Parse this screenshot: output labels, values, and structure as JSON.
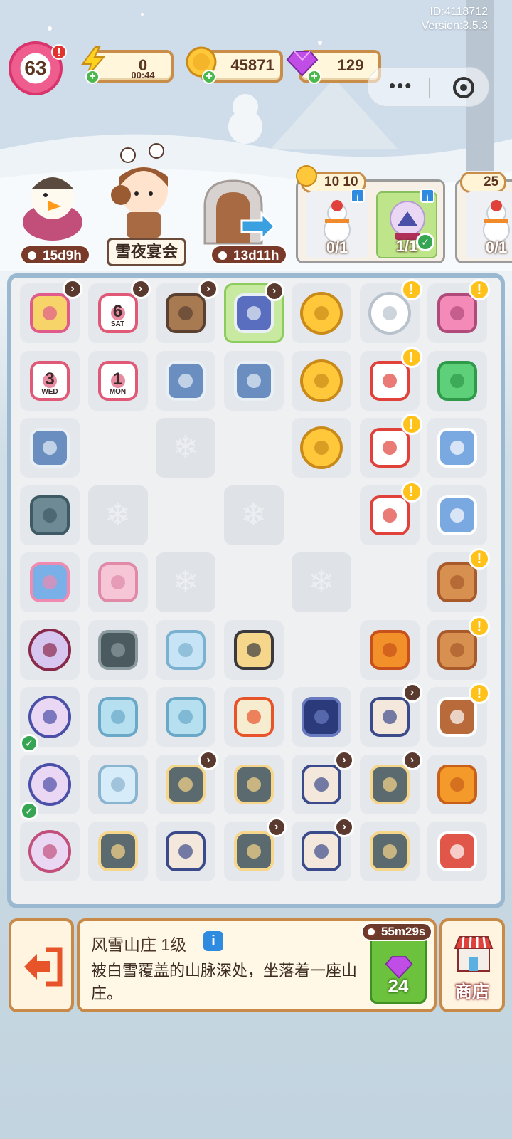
{
  "header": {
    "player_id": "ID:4118712",
    "version": "Version:3.5.3",
    "level": "63",
    "level_alert": "!",
    "energy": {
      "value": "0",
      "timer": "00:44",
      "icon": "lightning-icon"
    },
    "coins": {
      "value": "45871",
      "icon": "coin-icon"
    },
    "gems": {
      "value": "129",
      "icon": "gem-icon"
    },
    "plus": "+",
    "capsule": {
      "more": "•••",
      "close_icon": "record-icon"
    }
  },
  "events": {
    "penguin_timer": "15d9h",
    "banquet_label": "雪夜宴会",
    "door_timer": "13d11h"
  },
  "orders": [
    {
      "cost_coins": "10",
      "cost_coins2": "10",
      "slots": [
        {
          "progress": "0/1",
          "done": false
        },
        {
          "progress": "1/1",
          "done": true
        }
      ]
    },
    {
      "cost_coins": "25",
      "slots": [
        {
          "progress": "0/1",
          "done": false
        }
      ]
    }
  ],
  "board": {
    "rows": [
      [
        "cake-box",
        "calendar-6",
        "stone-door",
        "snow-manor",
        "coin-pile",
        "snowball",
        "sewing-machine"
      ],
      [
        "calendar-3",
        "calendar-1",
        "snowy-trees",
        "snowy-trees",
        "coin-pair",
        "santa-bag",
        "infinity-hex"
      ],
      [
        "snowy-trees",
        "empty",
        "frozen",
        "empty",
        "coin-quad",
        "santa-bag",
        "blue-mitten"
      ],
      [
        "handcuff",
        "frozen",
        "empty",
        "frozen",
        "empty",
        "santa-bag",
        "blue-mitten"
      ],
      [
        "scissors",
        "ribbon",
        "frozen",
        "empty",
        "frozen",
        "empty",
        "cookie"
      ],
      [
        "snow-globe-small",
        "stone-web",
        "ice-dragon",
        "candelabra",
        "empty",
        "scarf",
        "cookie"
      ],
      [
        "snow-globe",
        "ice-cobra",
        "ice-horse",
        "candles",
        "pants",
        "vest",
        "gingerbread-house"
      ],
      [
        "snow-globe",
        "ice-fox",
        "mirror-candle",
        "mirror-candle",
        "vest",
        "mirror-candle",
        "orange-jar"
      ],
      [
        "snow-globe-big",
        "mirror-candle",
        "vest",
        "mirror-candle",
        "vest",
        "mirror-candle",
        "red-gift-box"
      ]
    ],
    "day_labels": {
      "calendar-6": "6",
      "calendar-6-sub": "SAT",
      "calendar-3": "3",
      "calendar-3-sub": "WED",
      "calendar-1": "1",
      "calendar-1-sub": "MON"
    }
  },
  "detail": {
    "title": "风雪山庄 1级",
    "info": "i",
    "description": "被白雪覆盖的山脉深处，坐落着一座山庄。",
    "timer": "55m29s",
    "speed_cost": "24"
  },
  "shop": {
    "label": "商店"
  },
  "colors": {
    "board_border": "#9ab8d0",
    "panel_border": "#c88a48",
    "speed_green": "#6cc23c",
    "alert_yellow": "#ffc21a",
    "check_green": "#35a552"
  }
}
